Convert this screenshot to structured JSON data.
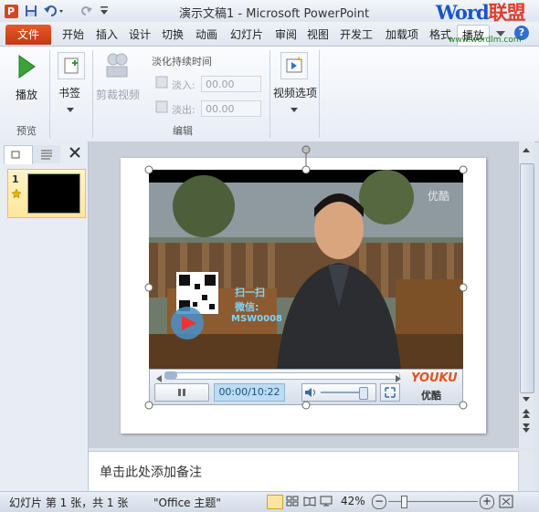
{
  "window": {
    "title": "演示文稿1 - Microsoft PowerPoint",
    "app_icon": "P"
  },
  "watermark": {
    "brand_part1": "Word",
    "brand_part2": "联盟",
    "url": "www.wordlm.com"
  },
  "tabs": [
    {
      "label": "文件"
    },
    {
      "label": "开始"
    },
    {
      "label": "插入"
    },
    {
      "label": "设计"
    },
    {
      "label": "切换"
    },
    {
      "label": "动画"
    },
    {
      "label": "幻灯片"
    },
    {
      "label": "审阅"
    },
    {
      "label": "视图"
    },
    {
      "label": "开发工"
    },
    {
      "label": "加载项"
    },
    {
      "label": "格式"
    },
    {
      "label": "播放"
    }
  ],
  "ribbon": {
    "preview": {
      "group": "预览",
      "play_label": "播放"
    },
    "bookmark": {
      "label": "书签"
    },
    "edit": {
      "group": "编辑",
      "trim_label": "剪裁视频",
      "fade_title": "淡化持续时间",
      "fade_in_label": "淡入:",
      "fade_in_value": "00.00",
      "fade_out_label": "淡出:",
      "fade_out_value": "00.00"
    },
    "video_options": {
      "label": "视频选项"
    }
  },
  "slides_pane": {
    "slide_number": "1"
  },
  "video": {
    "logo_top": "优酷",
    "qr_text1": "扫一扫",
    "qr_text2": "微信:",
    "qr_text3": "MSW0008",
    "time": "00:00/10:22",
    "progress": 0.0,
    "volume": 0.85,
    "youku_logo": "YOUKU",
    "youku_cn": "优酷"
  },
  "notes": {
    "placeholder": "单击此处添加备注"
  },
  "status": {
    "slide_info": "幻灯片 第 1 张，共 1 张",
    "theme": "\"Office 主题\"",
    "zoom": "42%"
  }
}
